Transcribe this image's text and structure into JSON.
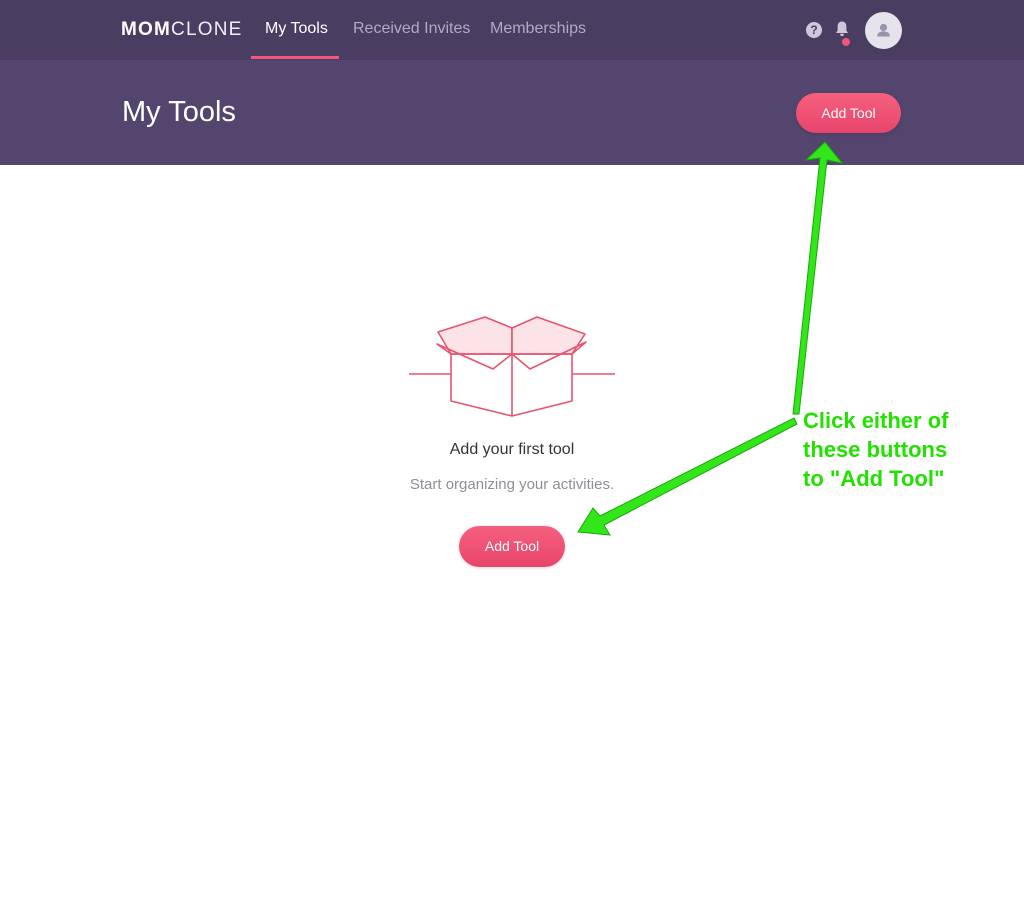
{
  "nav": {
    "brand_bold": "MOM",
    "brand_light": "CLONE",
    "tabs": [
      {
        "label": "My Tools",
        "active": true
      },
      {
        "label": "Received Invites",
        "active": false
      },
      {
        "label": "Memberships",
        "active": false
      }
    ],
    "help_symbol": "?"
  },
  "header": {
    "title": "My Tools",
    "add_button": "Add Tool"
  },
  "empty_state": {
    "title": "Add your first tool",
    "subtitle": "Start organizing your activities.",
    "add_button": "Add Tool"
  },
  "annotation": {
    "lines": [
      "Click either of",
      "these buttons",
      "to \"Add Tool\""
    ]
  },
  "colors": {
    "nav_bg": "#4a3d62",
    "header_bg": "#53456d",
    "accent_pink": "#f0577a",
    "annotation_green": "#22e000"
  },
  "icons": [
    "help-icon",
    "bell-icon",
    "avatar-user-icon",
    "open-box-icon"
  ]
}
